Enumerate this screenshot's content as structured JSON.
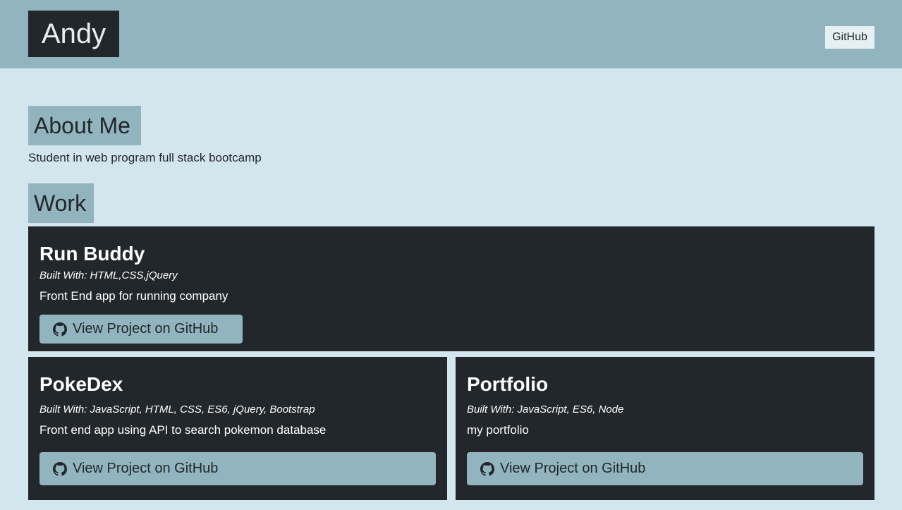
{
  "header": {
    "brand": "Andy",
    "nav_link": "GitHub"
  },
  "about": {
    "heading": "About Me",
    "text": "Student in web program full stack bootcamp"
  },
  "work": {
    "heading": "Work",
    "projects": [
      {
        "title": "Run Buddy",
        "built_with": "Built With: HTML,CSS,jQuery",
        "description": "Front End app for running company",
        "button_label": "View Project on GitHub"
      },
      {
        "title": "PokeDex",
        "built_with": "Built With: JavaScript, HTML, CSS, ES6, jQuery, Bootstrap",
        "description": "Front end app using API to search pokemon database",
        "button_label": "View Project on GitHub"
      },
      {
        "title": "Portfolio",
        "built_with": "Built With: JavaScript, ES6, Node",
        "description": "my portfolio",
        "button_label": "View Project on GitHub"
      }
    ]
  },
  "colors": {
    "background": "#d4e6ed",
    "header": "#91b4be",
    "card": "#22272b",
    "text_light": "#ffffff"
  },
  "icons": {
    "project_button": "github-icon"
  }
}
